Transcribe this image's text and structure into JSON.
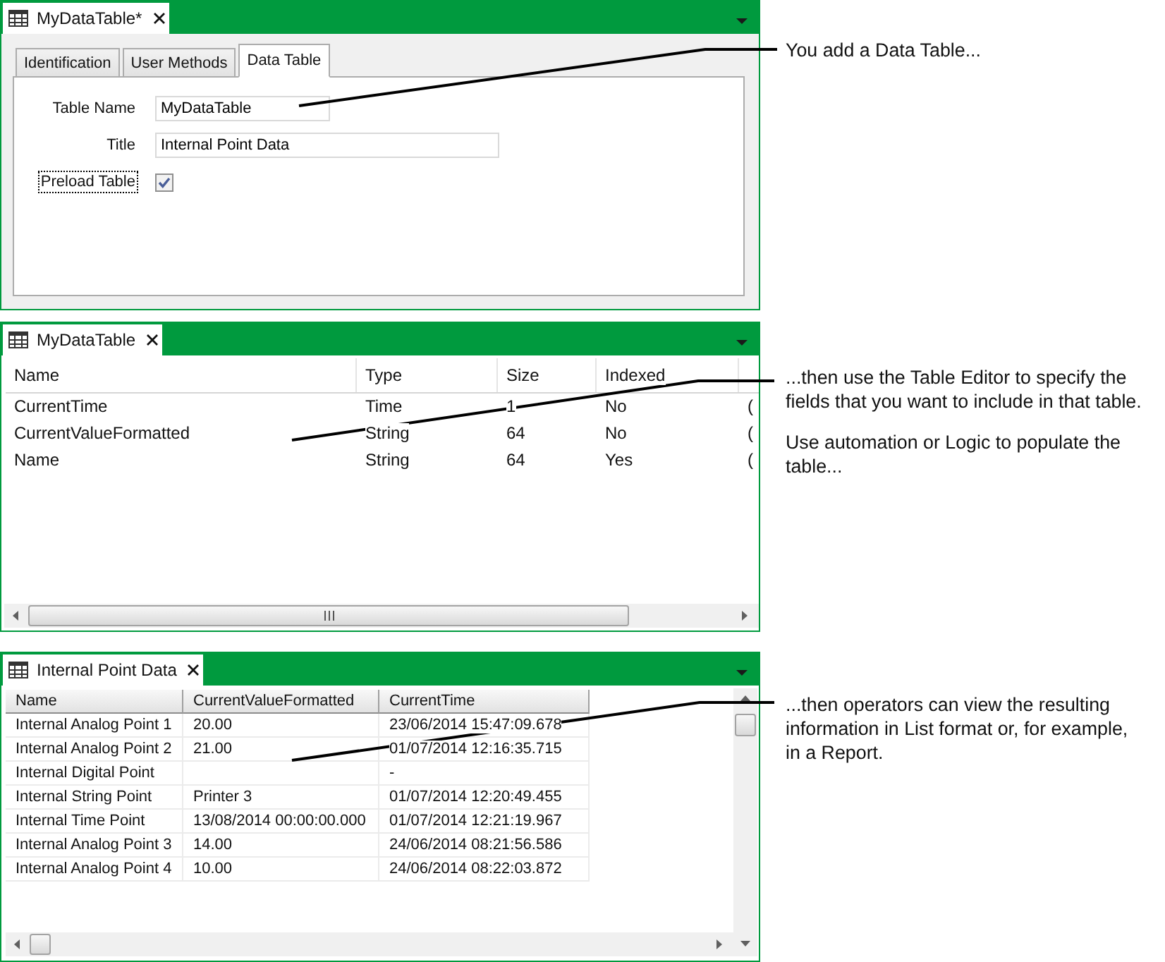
{
  "properties_panel": {
    "tab": {
      "title": "MyDataTable*"
    },
    "subtabs": [
      {
        "label": "Identification",
        "selected": false
      },
      {
        "label": "User Methods",
        "selected": false
      },
      {
        "label": "Data Table",
        "selected": true
      }
    ],
    "fields": [
      {
        "kind": "text",
        "label": "Table Name",
        "value": "MyDataTable"
      },
      {
        "kind": "text",
        "label": "Title",
        "value": "Internal Point Data"
      },
      {
        "kind": "checkbox",
        "label": "Preload Table",
        "checked": true,
        "focused": true
      }
    ]
  },
  "table_editor": {
    "tab": {
      "title": "MyDataTable"
    },
    "columns": [
      "Name",
      "Type",
      "Size",
      "Indexed"
    ],
    "rows": [
      [
        "CurrentTime",
        "Time",
        "1",
        "No",
        "("
      ],
      [
        "CurrentValueFormatted",
        "String",
        "64",
        "No",
        "("
      ],
      [
        "Name",
        "String",
        "64",
        "Yes",
        "("
      ]
    ]
  },
  "list_view": {
    "tab": {
      "title": "Internal Point Data"
    },
    "columns": [
      "Name",
      "CurrentValueFormatted",
      "CurrentTime"
    ],
    "rows": [
      [
        "Internal Analog Point 1",
        "20.00",
        "23/06/2014 15:47:09.678"
      ],
      [
        "Internal Analog Point 2",
        "21.00",
        "01/07/2014 12:16:35.715"
      ],
      [
        "Internal Digital Point",
        null,
        "-"
      ],
      [
        "Internal String Point",
        "Printer 3",
        "01/07/2014 12:20:49.455"
      ],
      [
        "Internal Time Point",
        "13/08/2014 00:00:00.000",
        "01/07/2014 12:21:19.967"
      ],
      [
        "Internal Analog Point 3",
        "14.00",
        "24/06/2014 08:21:56.586"
      ],
      [
        "Internal Analog Point 4",
        "10.00",
        "24/06/2014 08:22:03.872"
      ]
    ]
  },
  "annotations": [
    {
      "paragraphs": [
        "You add a Data Table..."
      ]
    },
    {
      "paragraphs": [
        "...then use the Table Editor to specify the fields that you want to include in that table.",
        "Use automation or Logic to populate the table..."
      ]
    },
    {
      "paragraphs": [
        "...then operators can view the resulting information in List format or, for example, in a Report."
      ]
    }
  ]
}
